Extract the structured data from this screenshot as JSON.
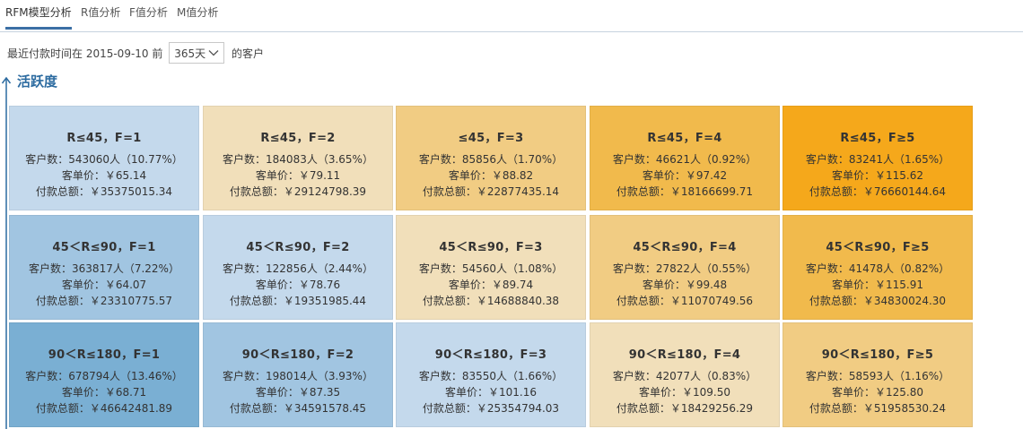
{
  "tabs": [
    {
      "label": "RFM模型分析",
      "active": true
    },
    {
      "label": "R值分析",
      "active": false
    },
    {
      "label": "F值分析",
      "active": false
    },
    {
      "label": "M值分析",
      "active": false
    }
  ],
  "filter": {
    "prefix": "最近付款时间在 2015-09-10 前",
    "selected": "365天",
    "suffix": "的客户"
  },
  "axis_label": "活跃度",
  "colors": {
    "tab_active": "#3b6fa5",
    "axis": "#2c6ba0",
    "blue_dark": "#7aafd3",
    "blue_mid": "#a1c5e1",
    "blue_light": "#c4d9ec",
    "beige": "#f1dfba",
    "orange_light": "#f1cc83",
    "orange_mid": "#f1ba4c",
    "orange_dark": "#f5a81b"
  },
  "grid": {
    "rows": [
      [
        {
          "title": "R≤45，F=1",
          "count": "客户数：543060人（10.77%）",
          "unit_price": "客单价：￥65.14",
          "total": "付款总额：￥35375015.34",
          "color": "#c4d9ec"
        },
        {
          "title": "R≤45，F=2",
          "count": "客户数：184083人（3.65%）",
          "unit_price": "客单价：￥79.11",
          "total": "付款总额：￥29124798.39",
          "color": "#f1dfba"
        },
        {
          "title": "≤45，F=3",
          "count": "客户数：85856人（1.70%）",
          "unit_price": "客单价：￥88.82",
          "total": "付款总额：￥22877435.14",
          "color": "#f1cc83"
        },
        {
          "title": "R≤45，F=4",
          "count": "客户数：46621人（0.92%）",
          "unit_price": "客单价：￥97.42",
          "total": "付款总额：￥18166699.71",
          "color": "#f1ba4c"
        },
        {
          "title": "R≤45，F≥5",
          "count": "客户数：83241人（1.65%）",
          "unit_price": "客单价：￥115.62",
          "total": "付款总额：￥76660144.64",
          "color": "#f5a81b"
        }
      ],
      [
        {
          "title": "45＜R≤90，F=1",
          "count": "客户数：363817人（7.22%）",
          "unit_price": "客单价：￥64.07",
          "total": "付款总额：￥23310775.57",
          "color": "#a1c5e1"
        },
        {
          "title": "45＜R≤90，F=2",
          "count": "客户数：122856人（2.44%）",
          "unit_price": "客单价：￥78.76",
          "total": "付款总额：￥19351985.44",
          "color": "#c4d9ec"
        },
        {
          "title": "45＜R≤90，F=3",
          "count": "客户数：54560人（1.08%）",
          "unit_price": "客单价：￥89.74",
          "total": "付款总额：￥14688840.38",
          "color": "#f1dfba"
        },
        {
          "title": "45＜R≤90，F=4",
          "count": "客户数：27822人（0.55%）",
          "unit_price": "客单价：￥99.48",
          "total": "付款总额：￥11070749.56",
          "color": "#f1cc83"
        },
        {
          "title": "45＜R≤90，F≥5",
          "count": "客户数：41478人（0.82%）",
          "unit_price": "客单价：￥115.91",
          "total": "付款总额：￥34830024.30",
          "color": "#f1ba4c"
        }
      ],
      [
        {
          "title": "90＜R≤180，F=1",
          "count": "客户数：678794人（13.46%）",
          "unit_price": "客单价：￥68.71",
          "total": "付款总额：￥46642481.89",
          "color": "#7aafd3"
        },
        {
          "title": "90＜R≤180，F=2",
          "count": "客户数：198014人（3.93%）",
          "unit_price": "客单价：￥87.35",
          "total": "付款总额：￥34591578.45",
          "color": "#a1c5e1"
        },
        {
          "title": "90＜R≤180，F=3",
          "count": "客户数：83550人（1.66%）",
          "unit_price": "客单价：￥101.16",
          "total": "付款总额：￥25354794.03",
          "color": "#c4d9ec"
        },
        {
          "title": "90＜R≤180，F=4",
          "count": "客户数：42077人（0.83%）",
          "unit_price": "客单价：￥109.50",
          "total": "付款总额：￥18429256.29",
          "color": "#f1dfba"
        },
        {
          "title": "90＜R≤180，F≥5",
          "count": "客户数：58593人（1.16%）",
          "unit_price": "客单价：￥125.80",
          "total": "付款总额：￥51958530.24",
          "color": "#f1cc83"
        }
      ]
    ]
  }
}
